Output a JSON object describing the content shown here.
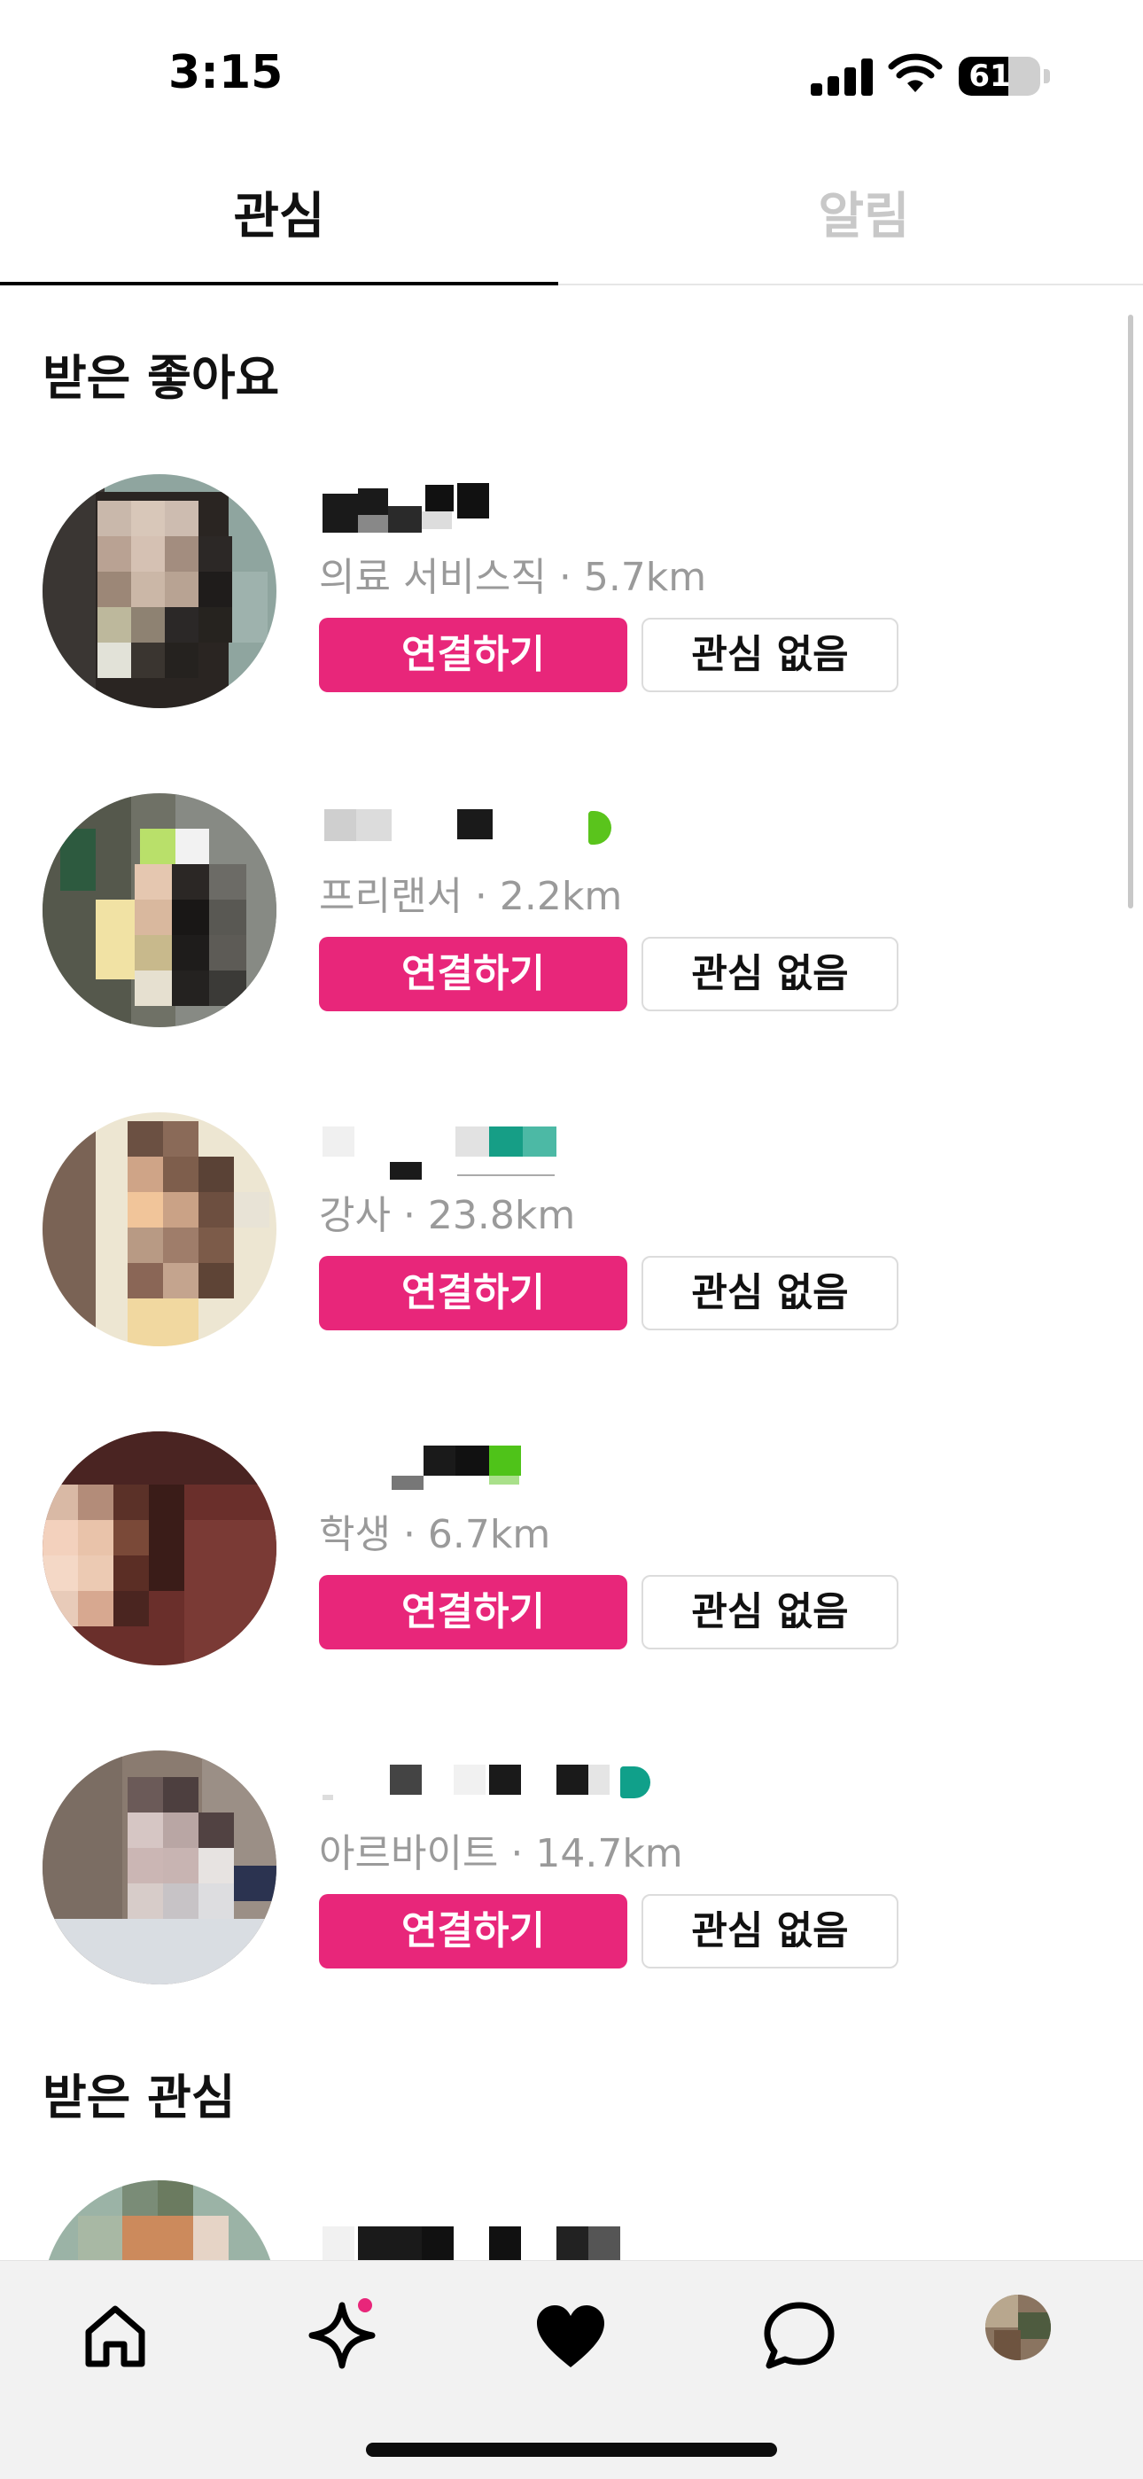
{
  "status_bar": {
    "time": "3:15",
    "battery": "61",
    "battery_level": 0.61
  },
  "tabs": [
    {
      "label": "관심",
      "active": true
    },
    {
      "label": "알림",
      "active": false
    }
  ],
  "sections": {
    "likes_title": "받은 좋아요",
    "interest_title": "받은 관심"
  },
  "cards": [
    {
      "subtitle": "의료 서비스직 · 5.7km",
      "connect_label": "연결하기",
      "pass_label": "관심 없음"
    },
    {
      "subtitle": "프리랜서 · 2.2km",
      "connect_label": "연결하기",
      "pass_label": "관심 없음"
    },
    {
      "subtitle": "강사 · 23.8km",
      "connect_label": "연결하기",
      "pass_label": "관심 없음"
    },
    {
      "subtitle": "학생 · 6.7km",
      "connect_label": "연결하기",
      "pass_label": "관심 없음"
    },
    {
      "subtitle": "아르바이트 · 14.7km",
      "connect_label": "연결하기",
      "pass_label": "관심 없음"
    }
  ],
  "colors": {
    "accent": "#e8267a",
    "inactive_tab": "#c8c8c8",
    "subtitle": "#9a9a9a",
    "nav_dot": "#e8267a"
  },
  "bottom_nav": {
    "items": [
      {
        "icon": "home-icon"
      },
      {
        "icon": "sparkle-icon",
        "badge": true
      },
      {
        "icon": "heart-icon",
        "active": true
      },
      {
        "icon": "chat-bubble-icon"
      },
      {
        "icon": "profile-avatar"
      }
    ]
  }
}
